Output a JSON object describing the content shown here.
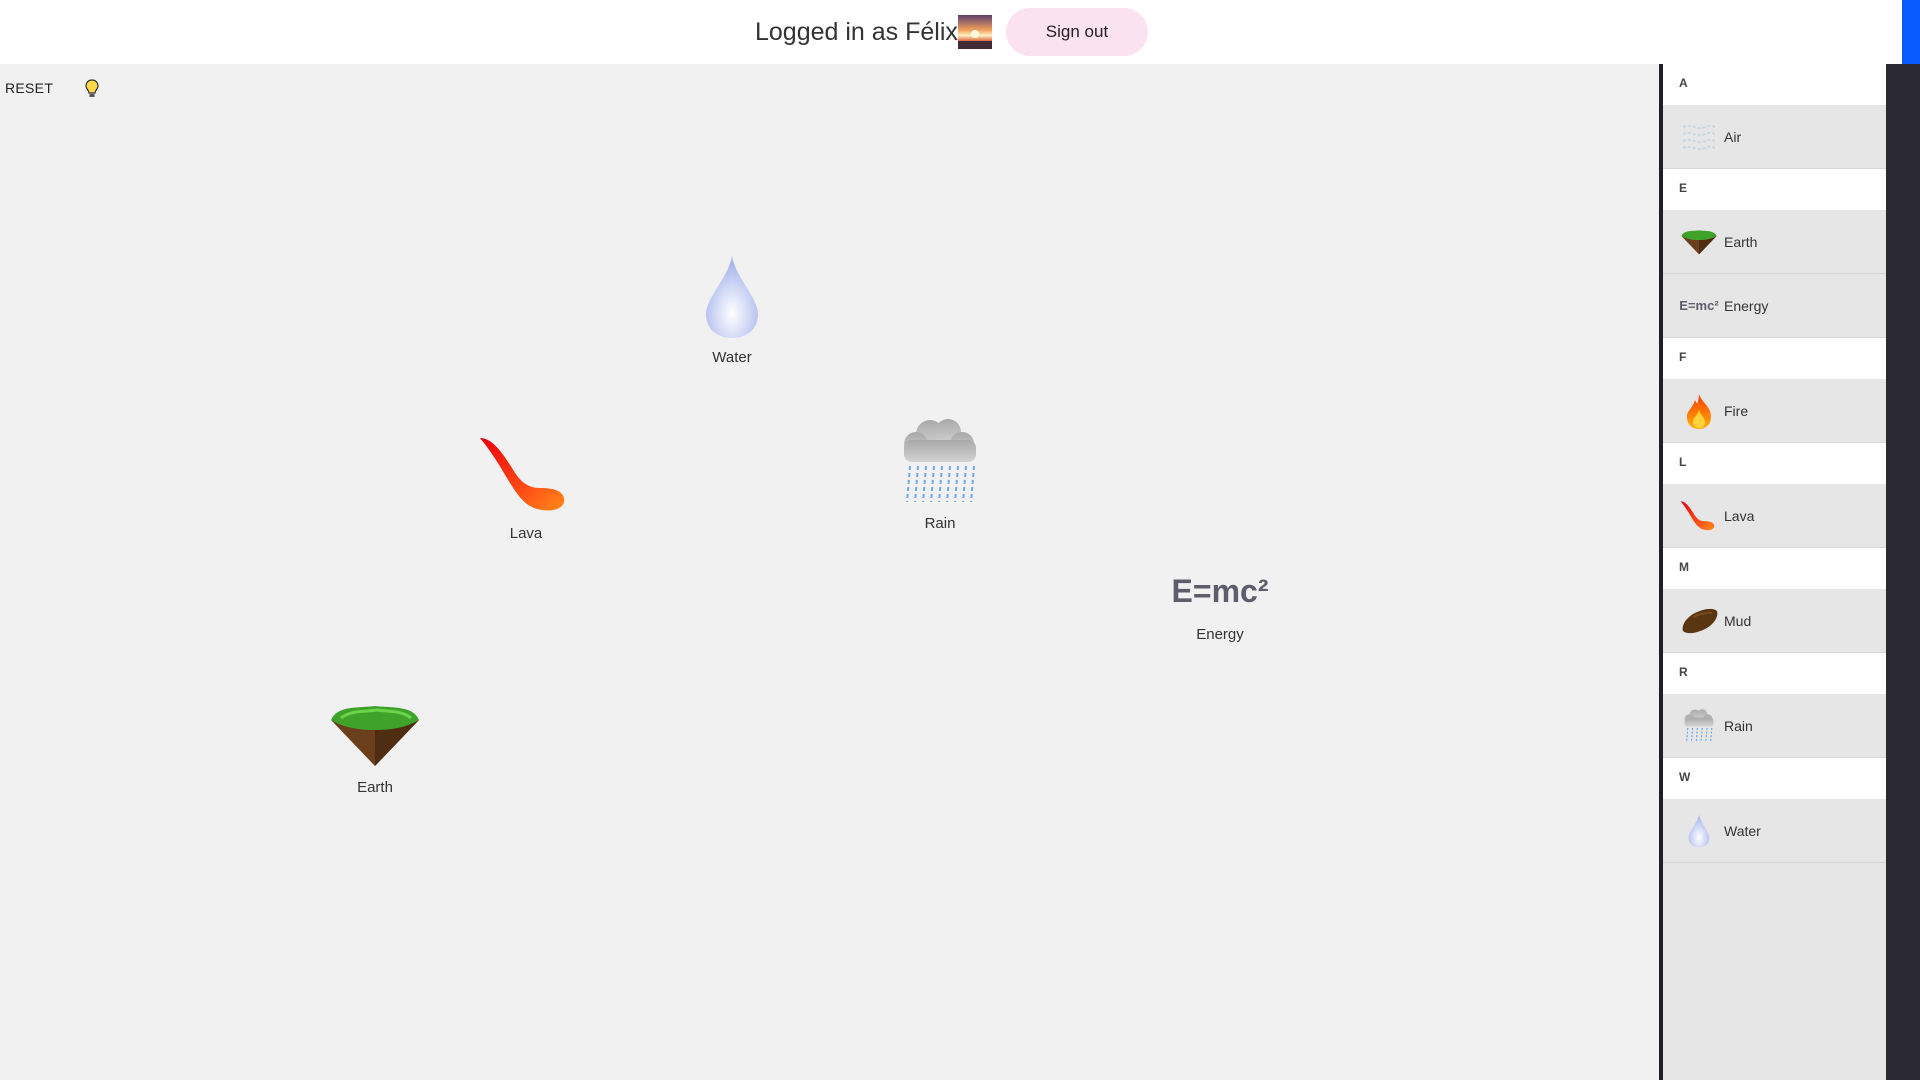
{
  "header": {
    "logged_in_text": "Logged in as Félix",
    "avatar_icon": "sunset-photo-avatar",
    "sign_out_label": "Sign out"
  },
  "workspace": {
    "reset_label": "RESET",
    "hint_icon": "lightbulb-icon",
    "elements": [
      {
        "label": "Water",
        "icon": "water-drop-icon"
      },
      {
        "label": "Lava",
        "icon": "lava-flow-icon"
      },
      {
        "label": "Rain",
        "icon": "rain-cloud-icon"
      },
      {
        "label": "Energy",
        "icon": "energy-formula-icon",
        "icon_text": "E=mc²"
      },
      {
        "label": "Earth",
        "icon": "earth-island-icon"
      }
    ]
  },
  "sidebar": {
    "groups": [
      {
        "letter": "A",
        "items": [
          {
            "label": "Air",
            "icon": "air-icon"
          }
        ]
      },
      {
        "letter": "E",
        "items": [
          {
            "label": "Earth",
            "icon": "earth-island-icon"
          },
          {
            "label": "Energy",
            "icon": "energy-formula-icon",
            "icon_text": "E=mc²"
          }
        ]
      },
      {
        "letter": "F",
        "items": [
          {
            "label": "Fire",
            "icon": "fire-icon"
          }
        ]
      },
      {
        "letter": "L",
        "items": [
          {
            "label": "Lava",
            "icon": "lava-flow-icon"
          }
        ]
      },
      {
        "letter": "M",
        "items": [
          {
            "label": "Mud",
            "icon": "mud-icon"
          }
        ]
      },
      {
        "letter": "R",
        "items": [
          {
            "label": "Rain",
            "icon": "rain-cloud-icon"
          }
        ]
      },
      {
        "letter": "W",
        "items": [
          {
            "label": "Water",
            "icon": "water-drop-icon"
          }
        ]
      }
    ]
  },
  "colors": {
    "sign_out_bg": "#fbe2f1",
    "workspace_bg": "#f1f1f1",
    "sidebar_bg": "#e6e6e6",
    "accent_blue": "#0a5bff"
  }
}
